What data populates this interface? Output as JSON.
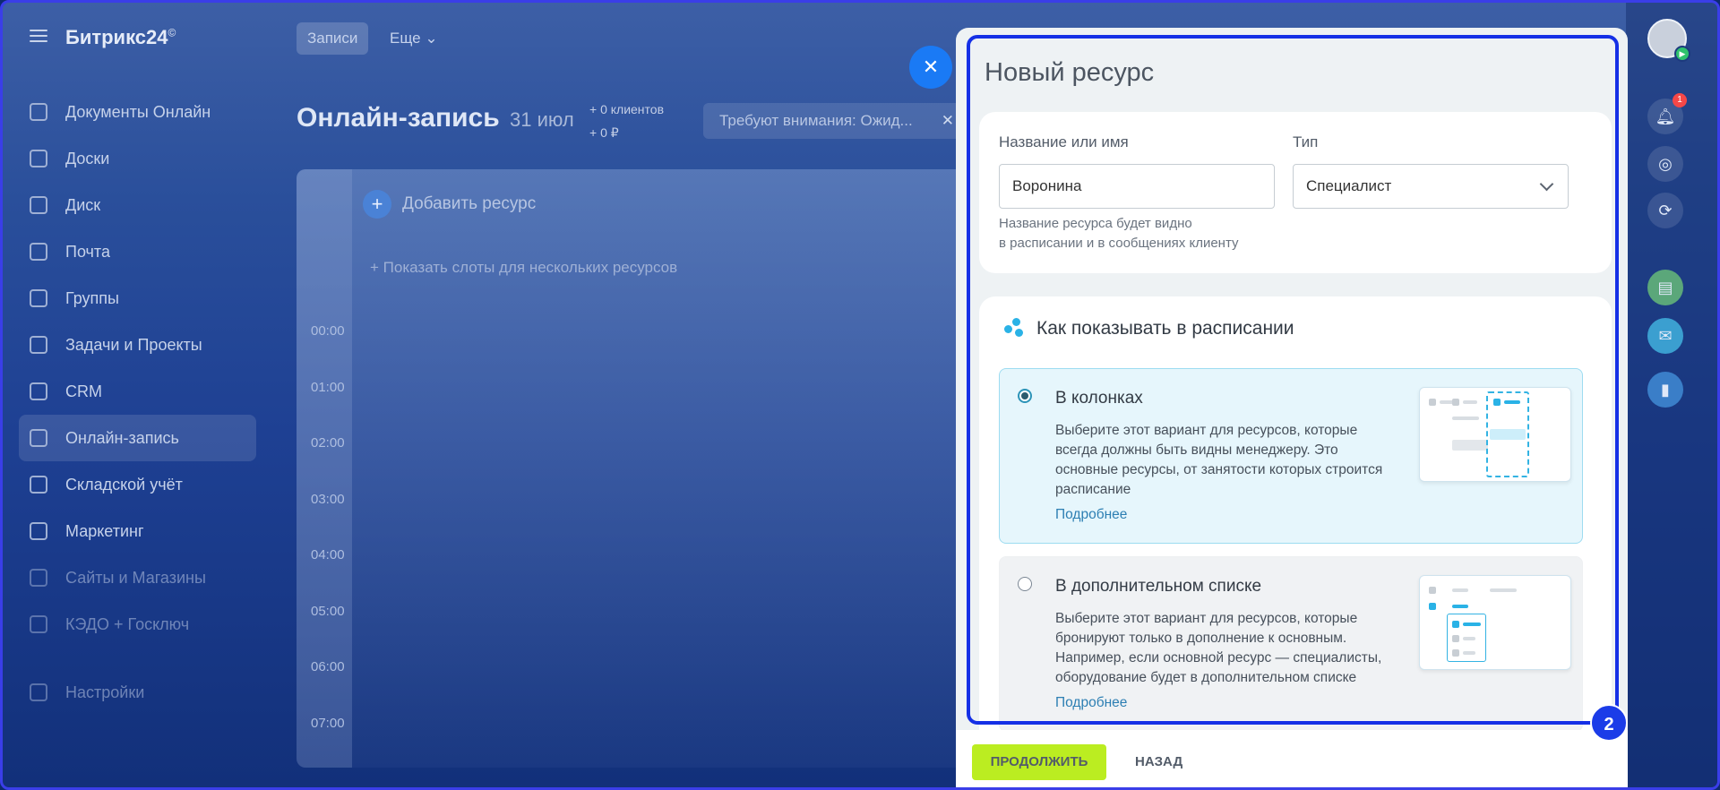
{
  "app": {
    "logo": "Битрикс24",
    "logo_mark": "©",
    "top_tabs": [
      "Записи",
      "Еще"
    ]
  },
  "sidebar": {
    "items": [
      {
        "label": "Документы Онлайн",
        "icon": "document-icon"
      },
      {
        "label": "Доски",
        "icon": "board-icon"
      },
      {
        "label": "Диск",
        "icon": "disk-icon"
      },
      {
        "label": "Почта",
        "icon": "mail-icon"
      },
      {
        "label": "Группы",
        "icon": "groups-icon"
      },
      {
        "label": "Задачи и Проекты",
        "icon": "tasks-icon"
      },
      {
        "label": "CRM",
        "icon": "crm-icon"
      },
      {
        "label": "Онлайн-запись",
        "icon": "booking-icon",
        "active": true
      },
      {
        "label": "Складской учёт",
        "icon": "warehouse-icon"
      },
      {
        "label": "Маркетинг",
        "icon": "marketing-icon"
      },
      {
        "label": "Сайты и Магазины",
        "icon": "sites-icon"
      },
      {
        "label": "КЭДО + Госключ",
        "icon": "kedo-icon"
      },
      {
        "label": "Настройки",
        "icon": "settings-icon"
      }
    ]
  },
  "page": {
    "title": "Онлайн-запись",
    "date": "31 июл",
    "clients": "+ 0 клиентов",
    "amount": "+ 0 ₽",
    "attention": "Требуют внимания: Ожид...",
    "add_resource": "Добавить ресурс",
    "show_slots": "+ Показать слоты для нескольких ресурсов",
    "times": [
      "00:00",
      "01:00",
      "02:00",
      "03:00",
      "04:00",
      "05:00",
      "06:00",
      "07:00"
    ]
  },
  "right_rail": {
    "notification_count": "1"
  },
  "panel": {
    "title": "Новый ресурс",
    "name_label": "Название или имя",
    "name_value": "Воронина",
    "name_hint_1": "Название ресурса будет видно",
    "name_hint_2": "в расписании и в сообщениях клиенту",
    "type_label": "Тип",
    "type_value": "Специалист",
    "display_title": "Как показывать в расписании",
    "options": [
      {
        "title": "В колонках",
        "description": "Выберите этот вариант для ресурсов, которые всегда должны быть видны менеджеру. Это основные ресурсы, от занятости которых строится расписание",
        "link": "Подробнее",
        "selected": true
      },
      {
        "title": "В дополнительном списке",
        "description": "Выберите этот вариант для ресурсов, которые бронируют только в дополнение к основным. Например, если основной ресурс — специалисты, оборудование будет в дополнительном списке",
        "link": "Подробнее",
        "selected": false
      }
    ],
    "continue_label": "ПРОДОЛЖИТЬ",
    "back_label": "НАЗАД"
  },
  "annotation": {
    "step_number": "2",
    "color": "#1530e6"
  },
  "colors": {
    "accent_button": "#bbed21",
    "link": "#2d7fb3",
    "selected_option_bg": "#e6f6fc"
  }
}
